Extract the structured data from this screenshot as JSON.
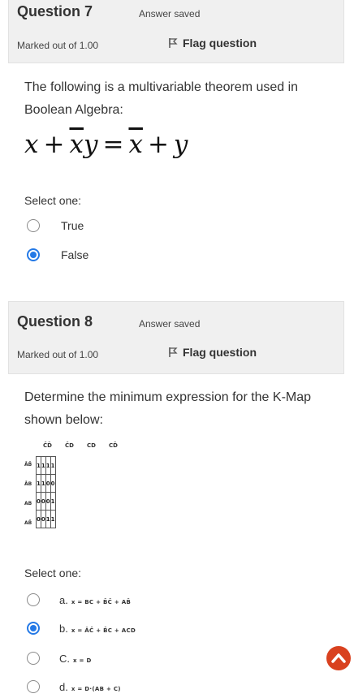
{
  "q7": {
    "title": "Question 7",
    "state": "Answer saved",
    "mark": "Marked out of 1.00",
    "flag_label": "Flag question",
    "text": "The following is a multivariable theorem used in Boolean Algebra:",
    "formula": {
      "x": "x",
      "plus": "+",
      "xbar": "x",
      "y": "y",
      "eq": "=",
      "xbar2": "x",
      "plus2": "+",
      "y2": "y"
    },
    "select_label": "Select one:",
    "options": [
      {
        "label": "True",
        "checked": false
      },
      {
        "label": "False",
        "checked": true
      }
    ]
  },
  "q8": {
    "title": "Question 8",
    "state": "Answer saved",
    "mark": "Marked out of 1.00",
    "flag_label": "Flag question",
    "text": "Determine the minimum expression for the K-Map shown below:",
    "kmap": {
      "col_headers": [
        "C̄D̄",
        "C̄D",
        "CD",
        "CD̄"
      ],
      "row_headers": [
        "ĀB̄",
        "ĀB",
        "AB",
        "AB̄"
      ],
      "cells": [
        [
          "1",
          "1",
          "1",
          "1"
        ],
        [
          "1",
          "1",
          "0",
          "0"
        ],
        [
          "0",
          "0",
          "0",
          "1"
        ],
        [
          "0",
          "0",
          "1",
          "1"
        ]
      ]
    },
    "select_label": "Select one:",
    "options": [
      {
        "prefix": "a.",
        "expr": "x = BC + B̄C̄ + AB̄",
        "checked": false
      },
      {
        "prefix": "b.",
        "expr": "x = ĀC̄ + B̄C + ACD",
        "checked": true
      },
      {
        "prefix": "C.",
        "expr": "x = D",
        "checked": false
      },
      {
        "prefix": "d.",
        "expr": "x = D·(AB + C)",
        "checked": false
      }
    ]
  },
  "colors": {
    "accent": "#2479e6",
    "nav_button": "#d9411f",
    "header_bg": "#f0f0f0"
  },
  "icons": {
    "flag": "flag-icon",
    "nav": "chevron-up-icon"
  }
}
